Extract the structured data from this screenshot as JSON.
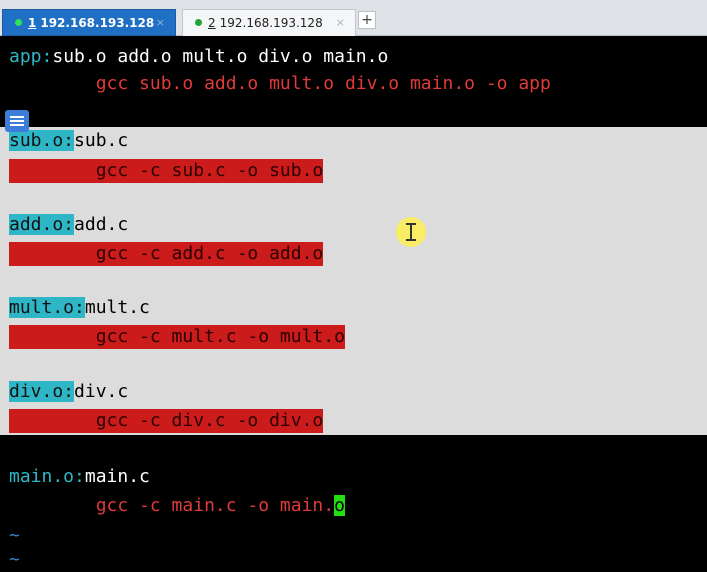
{
  "tabs": [
    {
      "number": "1",
      "label": "192.168.193.128",
      "status_color": "#2ee05a",
      "active": true,
      "close": "×"
    },
    {
      "number": "2",
      "label": "192.168.193.128",
      "status_color": "#22a43a",
      "active": false,
      "close": "×"
    }
  ],
  "new_tab_label": "+",
  "terminal": {
    "app_rule": {
      "target": "app:",
      "deps": "sub.o add.o mult.o div.o main.o"
    },
    "app_cmd": "        gcc sub.o add.o mult.o div.o main.o -o app",
    "rules": [
      {
        "target": "sub.o:",
        "deps": "sub.c",
        "cmd": "        gcc -c sub.c -o sub.o"
      },
      {
        "target": "add.o:",
        "deps": "add.c",
        "cmd": "        gcc -c add.c -o add.o"
      },
      {
        "target": "mult.o:",
        "deps": "mult.c",
        "cmd": "        gcc -c mult.c -o mult.o"
      },
      {
        "target": "div.o:",
        "deps": "div.c",
        "cmd": "        gcc -c div.c -o div.o"
      }
    ],
    "main_rule": {
      "target": "main.o:",
      "deps": "main.c"
    },
    "main_cmd_before_cursor": "        gcc -c main.c -o main.",
    "cursor_char": "o",
    "tilde_lines": [
      "~",
      "~"
    ]
  },
  "colors": {
    "target": "#2fb6c6",
    "command": "#e03a3a",
    "selection": "#dcdcdc",
    "cursor": "#22e010"
  }
}
